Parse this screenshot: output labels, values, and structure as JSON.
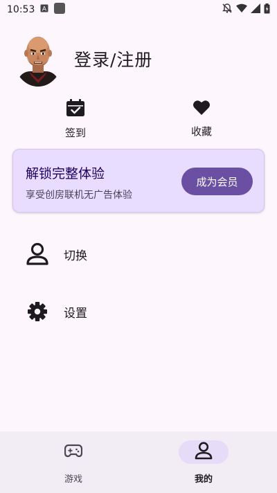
{
  "status_bar": {
    "time": "10:53"
  },
  "profile": {
    "login_label": "登录/注册"
  },
  "quick_actions": [
    {
      "label": "签到",
      "icon": "calendar-check-icon"
    },
    {
      "label": "收藏",
      "icon": "heart-icon"
    }
  ],
  "vip": {
    "title": "解锁完整体验",
    "subtitle": "享受创房联机无广告体验",
    "button": "成为会员"
  },
  "menu": [
    {
      "label": "切换",
      "icon": "person-icon"
    },
    {
      "label": "设置",
      "icon": "gear-icon"
    }
  ],
  "bottom_nav": {
    "items": [
      {
        "label": "游戏",
        "icon": "gamepad-icon",
        "active": false
      },
      {
        "label": "我的",
        "icon": "person-icon",
        "active": true
      }
    ]
  },
  "colors": {
    "background": "#fdf7fd",
    "vip_card": "#e9ddff",
    "vip_button": "#6a4fa3",
    "nav_bar": "#f2ecf4",
    "nav_active_pill": "#e7dcf7"
  }
}
